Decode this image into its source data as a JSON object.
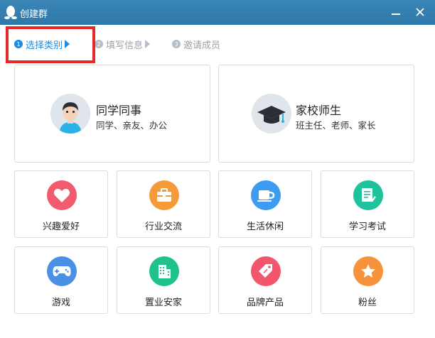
{
  "window": {
    "title": "创建群"
  },
  "steps": [
    {
      "num": "1",
      "label": "选择类别"
    },
    {
      "num": "2",
      "label": "填写信息"
    },
    {
      "num": "3",
      "label": "邀请成员"
    }
  ],
  "categories_main": [
    {
      "name": "同学同事",
      "desc": "同学、亲友、办公",
      "icon": "student-avatar-icon"
    },
    {
      "name": "家校师生",
      "desc": "班主任、老师、家长",
      "icon": "graduation-cap-icon"
    }
  ],
  "categories": [
    {
      "name": "兴趣爱好",
      "icon": "heart-icon",
      "color": "#f25a6e"
    },
    {
      "name": "行业交流",
      "icon": "briefcase-icon",
      "color": "#f59a3b"
    },
    {
      "name": "生活休闲",
      "icon": "coffee-cup-icon",
      "color": "#3d9bf0"
    },
    {
      "name": "学习考试",
      "icon": "document-pencil-icon",
      "color": "#1fc29a"
    },
    {
      "name": "游戏",
      "icon": "gamepad-icon",
      "color": "#4a90e6"
    },
    {
      "name": "置业安家",
      "icon": "building-icon",
      "color": "#20c28c"
    },
    {
      "name": "品牌产品",
      "icon": "tag-icon",
      "color": "#f2566c"
    },
    {
      "name": "粉丝",
      "icon": "star-icon",
      "color": "#f5923a"
    }
  ]
}
